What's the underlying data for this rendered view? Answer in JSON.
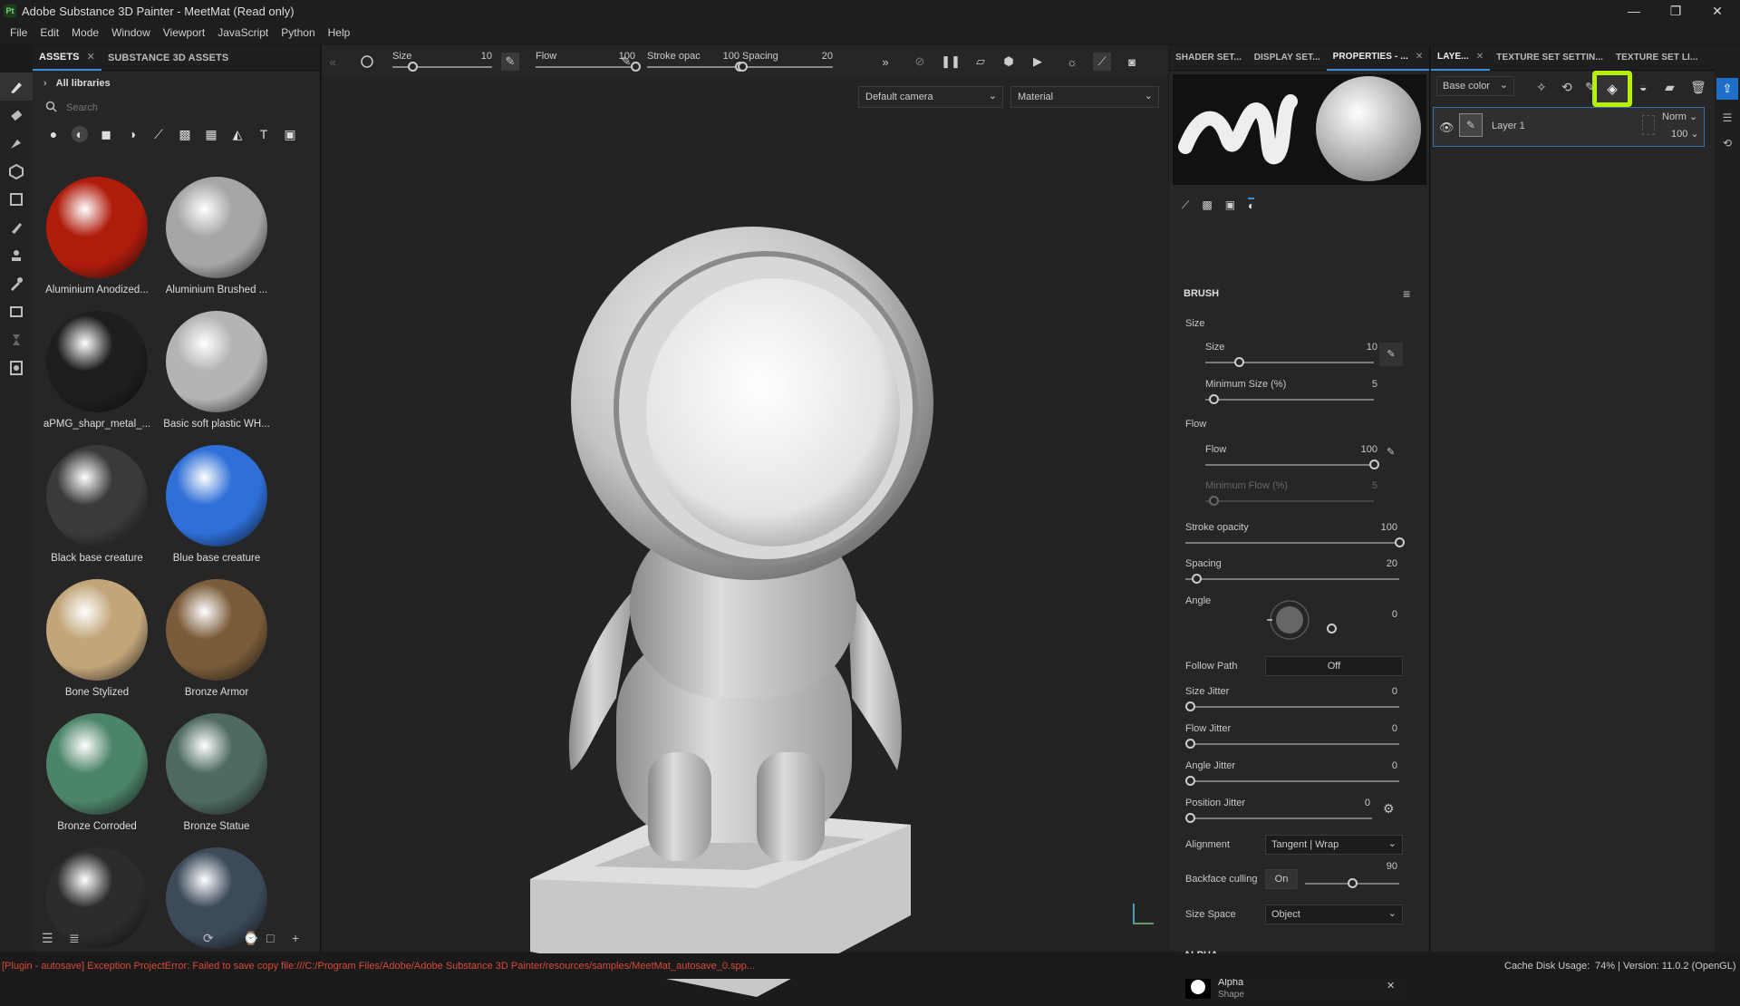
{
  "window": {
    "title": "Adobe Substance 3D Painter - MeetMat (Read only)",
    "app_icon": "Pt"
  },
  "menu": [
    "File",
    "Edit",
    "Mode",
    "Window",
    "Viewport",
    "JavaScript",
    "Python",
    "Help"
  ],
  "assets_panel": {
    "tabs": [
      {
        "label": "ASSETS",
        "active": true
      },
      {
        "label": "SUBSTANCE 3D ASSETS",
        "active": false
      }
    ],
    "library": "All libraries",
    "search_placeholder": "Search",
    "materials": [
      {
        "name": "Aluminium Anodized...",
        "color": "#b01c0c"
      },
      {
        "name": "Aluminium Brushed ...",
        "color": "#a4a6a8"
      },
      {
        "name": "aPMG_shapr_metal_...",
        "color": "#1e1e1e"
      },
      {
        "name": "Basic soft plastic WH...",
        "color": "#b4b4b4"
      },
      {
        "name": "Black base creature",
        "color": "#3a3a3a"
      },
      {
        "name": "Blue base creature",
        "color": "#2e6fd8"
      },
      {
        "name": "Bone Stylized",
        "color": "#c2a67a"
      },
      {
        "name": "Bronze Armor",
        "color": "#7a5c3a"
      },
      {
        "name": "Bronze Corroded",
        "color": "#4c8468"
      },
      {
        "name": "Bronze Statue",
        "color": "#4e6a62"
      },
      {
        "name": "",
        "color": "#2c2c2c"
      },
      {
        "name": "",
        "color": "#3c4a5a"
      }
    ]
  },
  "toolbar": {
    "size": {
      "label": "Size",
      "value": "10",
      "fraction": 0.2
    },
    "flow": {
      "label": "Flow",
      "value": "100",
      "fraction": 1.0
    },
    "stroke_opacity": {
      "label": "Stroke opac",
      "value": "100",
      "fraction": 1.0
    },
    "spacing": {
      "label": "Spacing",
      "value": "20",
      "fraction": 0.0
    }
  },
  "viewport": {
    "camera": "Default camera",
    "mode": "Material"
  },
  "properties": {
    "tabs": [
      "SHADER SET...",
      "DISPLAY SET...",
      "PROPERTIES - ..."
    ],
    "section_brush": "BRUSH",
    "size_group": "Size",
    "size": {
      "label": "Size",
      "value": "10",
      "fraction": 0.2
    },
    "min_size": {
      "label": "Minimum Size (%)",
      "value": "5",
      "fraction": 0.05
    },
    "flow_group": "Flow",
    "flow": {
      "label": "Flow",
      "value": "100",
      "fraction": 1.0
    },
    "min_flow": {
      "label": "Minimum Flow (%)",
      "value": "5",
      "fraction": 0.05
    },
    "stroke_opacity": {
      "label": "Stroke opacity",
      "value": "100",
      "fraction": 1.0
    },
    "spacing": {
      "label": "Spacing",
      "value": "20",
      "fraction": 0.05
    },
    "angle": {
      "label": "Angle",
      "value": "0"
    },
    "follow_path": {
      "label": "Follow Path",
      "value": "Off"
    },
    "size_jitter": {
      "label": "Size Jitter",
      "value": "0"
    },
    "flow_jitter": {
      "label": "Flow Jitter",
      "value": "0"
    },
    "angle_jitter": {
      "label": "Angle Jitter",
      "value": "0"
    },
    "position_jitter": {
      "label": "Position Jitter",
      "value": "0"
    },
    "alignment": {
      "label": "Alignment",
      "value": "Tangent | Wrap"
    },
    "backface_culling": {
      "label": "Backface culling",
      "toggle": "On",
      "value": "90",
      "fraction": 0.5
    },
    "size_space": {
      "label": "Size Space",
      "value": "Object"
    },
    "section_alpha": "ALPHA",
    "alpha_name": "Alpha",
    "alpha_sub": "Shape"
  },
  "layers": {
    "tabs": [
      "LAYE...",
      "TEXTURE SET SETTIN...",
      "TEXTURE SET LI..."
    ],
    "channel": "Base color",
    "layer_name": "Layer 1",
    "blend": "Norm",
    "opacity": "100",
    "highlight_color": "#b6f000"
  },
  "status": {
    "error": "[Plugin - autosave] Exception ProjectError: Failed to save copy file:///C:/Program Files/Adobe/Adobe Substance 3D Painter/resources/samples/MeetMat_autosave_0.spp...",
    "cache": "Cache Disk Usage:",
    "cache_value": "74% | Version: 11.0.2 (OpenGL)"
  }
}
